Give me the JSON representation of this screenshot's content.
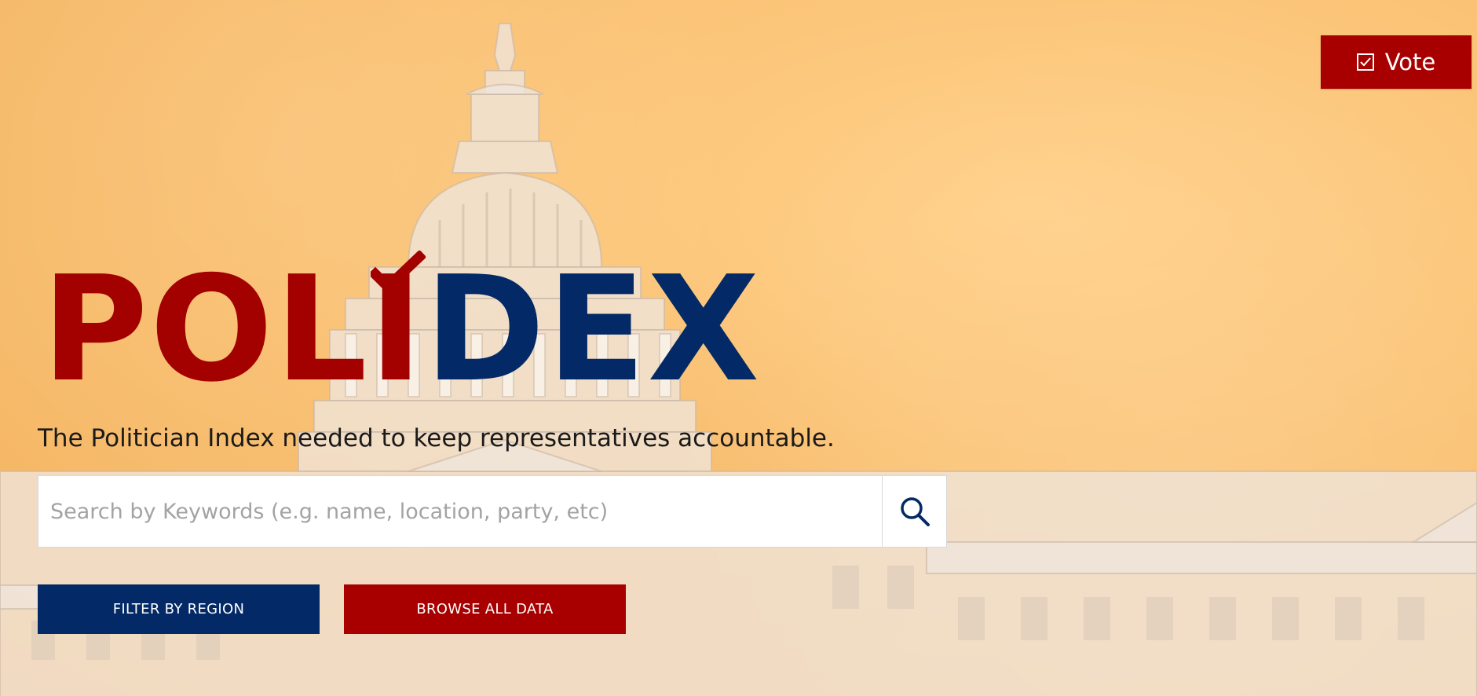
{
  "header": {
    "vote_label": "Vote",
    "vote_icon": "checkbox-icon"
  },
  "logo": {
    "part_red": "POL",
    "letter_i": "I",
    "part_blue": "DEX",
    "check_icon": "checkmark-icon",
    "colors": {
      "red": "#a30000",
      "blue": "#032966"
    }
  },
  "hero": {
    "tagline": "The Politician Index needed to keep representatives accountable."
  },
  "search": {
    "placeholder": "Search by Keywords (e.g. name, location, party, etc)",
    "value": "",
    "icon": "search-icon"
  },
  "actions": {
    "filter_label": "FILTER BY REGION",
    "browse_label": "BROWSE ALL DATA"
  },
  "colors": {
    "background": "#f9be6e",
    "accent_red": "#a80000",
    "accent_blue": "#032966"
  }
}
